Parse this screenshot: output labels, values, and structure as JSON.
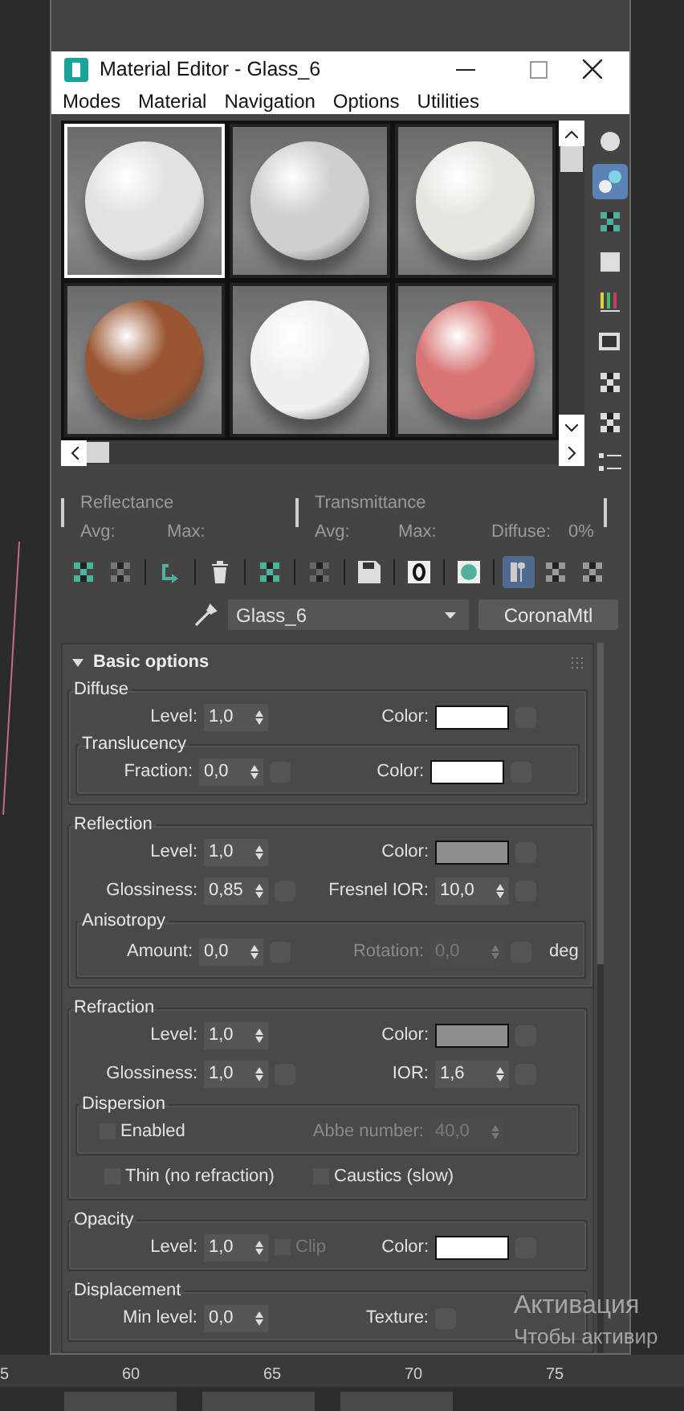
{
  "window": {
    "title": "Material Editor - Glass_6"
  },
  "menu": [
    "Modes",
    "Material",
    "Navigation",
    "Options",
    "Utilities"
  ],
  "samples": [
    {
      "color": "#e2e2e2",
      "selected": true
    },
    {
      "color": "#cfcfcf",
      "selected": false
    },
    {
      "color": "#e6e6e0",
      "selected": false
    },
    {
      "color": "#9a5632",
      "selected": false
    },
    {
      "color": "#f0f0f0",
      "selected": false
    },
    {
      "color": "#d87474",
      "selected": false
    }
  ],
  "side_tools": [
    {
      "selected": false
    },
    {
      "selected": true
    },
    {
      "selected": false
    },
    {
      "selected": false
    },
    {
      "selected": false
    },
    {
      "selected": false
    },
    {
      "selected": false
    },
    {
      "selected": false
    },
    {
      "selected": false
    }
  ],
  "reflectance": {
    "label": "Reflectance",
    "avg": "Avg:",
    "max": "Max:"
  },
  "transmittance": {
    "label": "Transmittance",
    "avg": "Avg:",
    "max": "Max:",
    "diffuse": "Diffuse:",
    "diffuse_value": "0%"
  },
  "tools": [
    {
      "selected": false
    },
    {
      "selected": false
    },
    {
      "selected": false
    },
    {
      "selected": false
    },
    {
      "selected": false
    },
    {
      "selected": false
    },
    {
      "selected": false
    },
    {
      "selected": false
    },
    {
      "selected": false
    },
    {
      "selected": true
    },
    {
      "selected": false
    },
    {
      "selected": false
    }
  ],
  "material": {
    "name": "Glass_6",
    "type": "CoronaMtl"
  },
  "rollout": {
    "title": "Basic options",
    "expanded": true
  },
  "sections": [
    {
      "title": "Diffuse",
      "rows": [
        [
          {
            "kind": "spinner",
            "label": "Level:",
            "value": "1,0",
            "map": false
          },
          {
            "kind": "color",
            "label": "Color:",
            "color": "#ffffff"
          }
        ]
      ],
      "groups": [
        {
          "title": "Translucency",
          "rows": [
            [
              {
                "kind": "spinner",
                "label": "Fraction:",
                "value": "0,0",
                "map": true
              },
              {
                "kind": "color",
                "label": "Color:",
                "color": "#ffffff"
              }
            ]
          ]
        }
      ]
    },
    {
      "title": "Reflection",
      "rows": [
        [
          {
            "kind": "spinner",
            "label": "Level:",
            "value": "1,0",
            "map": false
          },
          {
            "kind": "color",
            "label": "Color:",
            "color": "#8e8e8e"
          }
        ],
        [
          {
            "kind": "spinner",
            "label": "Glossiness:",
            "value": "0,85",
            "map": true
          },
          {
            "kind": "spinner",
            "label": "Fresnel IOR:",
            "value": "10,0",
            "map": true
          }
        ]
      ],
      "groups": [
        {
          "title": "Anisotropy",
          "rows": [
            [
              {
                "kind": "spinner",
                "label": "Amount:",
                "value": "0,0",
                "map": true
              },
              {
                "kind": "spinner",
                "label": "Rotation:",
                "value": "0,0",
                "map": true,
                "disabled": true,
                "suffix": "deg"
              }
            ]
          ]
        }
      ]
    },
    {
      "title": "Refraction",
      "rows": [
        [
          {
            "kind": "spinner",
            "label": "Level:",
            "value": "1,0",
            "map": false
          },
          {
            "kind": "color",
            "label": "Color:",
            "color": "#8e8e8e"
          }
        ],
        [
          {
            "kind": "spinner",
            "label": "Glossiness:",
            "value": "1,0",
            "map": true
          },
          {
            "kind": "spinner",
            "label": "IOR:",
            "value": "1,6",
            "map": true
          }
        ]
      ],
      "groups": [
        {
          "title": "Dispersion",
          "rows": [
            [
              {
                "kind": "check",
                "label": "Enabled",
                "checked": false,
                "disabled": false
              },
              {
                "kind": "spinner",
                "label": "Abbe number:",
                "value": "40,0",
                "map": false,
                "disabled": true
              }
            ]
          ]
        }
      ],
      "after": [
        [
          {
            "kind": "check",
            "label": "Thin (no refraction)",
            "checked": false,
            "disabled": false
          },
          {
            "kind": "check",
            "label": "Caustics (slow)",
            "checked": false,
            "disabled": false
          }
        ]
      ]
    },
    {
      "title": "Opacity",
      "rows": [
        [
          {
            "kind": "spinner",
            "label": "Level:",
            "value": "1,0",
            "map": false,
            "clip": {
              "label": "Clip",
              "checked": false,
              "disabled": true
            }
          },
          {
            "kind": "color",
            "label": "Color:",
            "color": "#ffffff"
          }
        ]
      ]
    },
    {
      "title": "Displacement",
      "rows": [
        [
          {
            "kind": "spinner",
            "label": "Min level:",
            "value": "0,0",
            "map": false
          },
          {
            "kind": "map",
            "label": "Texture:"
          }
        ]
      ]
    }
  ],
  "ruler": [
    "5",
    "60",
    "65",
    "70",
    "75"
  ],
  "activation": {
    "title": "Активация",
    "subtitle": "Чтобы активир"
  }
}
